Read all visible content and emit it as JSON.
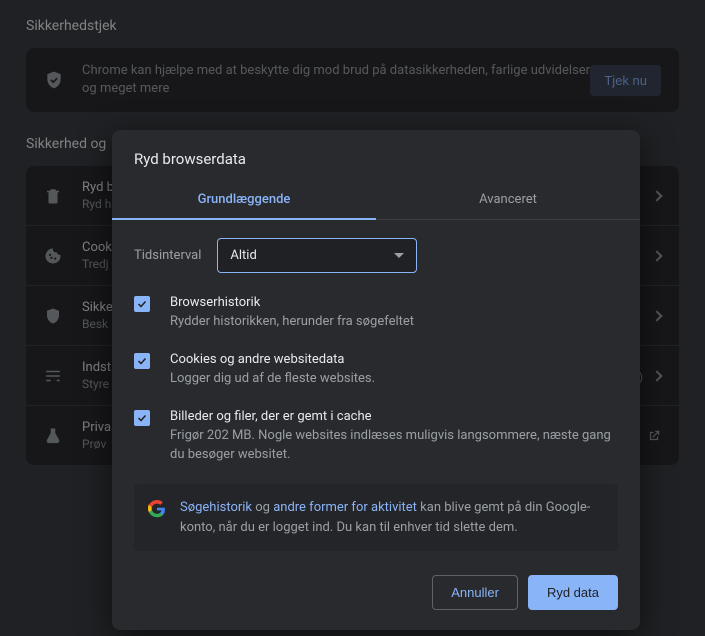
{
  "bg": {
    "section1_title": "Sikkerhedstjek",
    "card_text": "Chrome kan hjælpe med at beskytte dig mod brud på datasikkerheden, farlige udvidelser og meget mere",
    "card_button": "Tjek nu",
    "section2_title": "Sikkerhed og",
    "rows": [
      {
        "t": "Ryd b",
        "s": "Ryd h"
      },
      {
        "t": "Cook",
        "s": "Tredj"
      },
      {
        "t": "Sikke",
        "s": "Besk"
      },
      {
        "t": "Indst",
        "s": "Styre",
        "tail": "n.)"
      },
      {
        "t": "Priva",
        "s": "Prøv"
      }
    ]
  },
  "modal": {
    "title": "Ryd browserdata",
    "tab_basic": "Grundlæggende",
    "tab_advanced": "Avanceret",
    "interval_label": "Tidsinterval",
    "interval_value": "Altid",
    "options": [
      {
        "t": "Browserhistorik",
        "s": "Rydder historikken, herunder fra søgefeltet"
      },
      {
        "t": "Cookies og andre websitedata",
        "s": "Logger dig ud af de fleste websites."
      },
      {
        "t": "Billeder og filer, der er gemt i cache",
        "s": "Frigør 202 MB. Nogle websites indlæses muligvis langsommere, næste gang du besøger websitet."
      }
    ],
    "info_link1": "Søgehistorik",
    "info_mid1": " og ",
    "info_link2": "andre former for aktivitet",
    "info_rest": " kan blive gemt på din Google-konto, når du er logget ind. Du kan til enhver tid slette dem.",
    "cancel": "Annuller",
    "clear": "Ryd data"
  }
}
